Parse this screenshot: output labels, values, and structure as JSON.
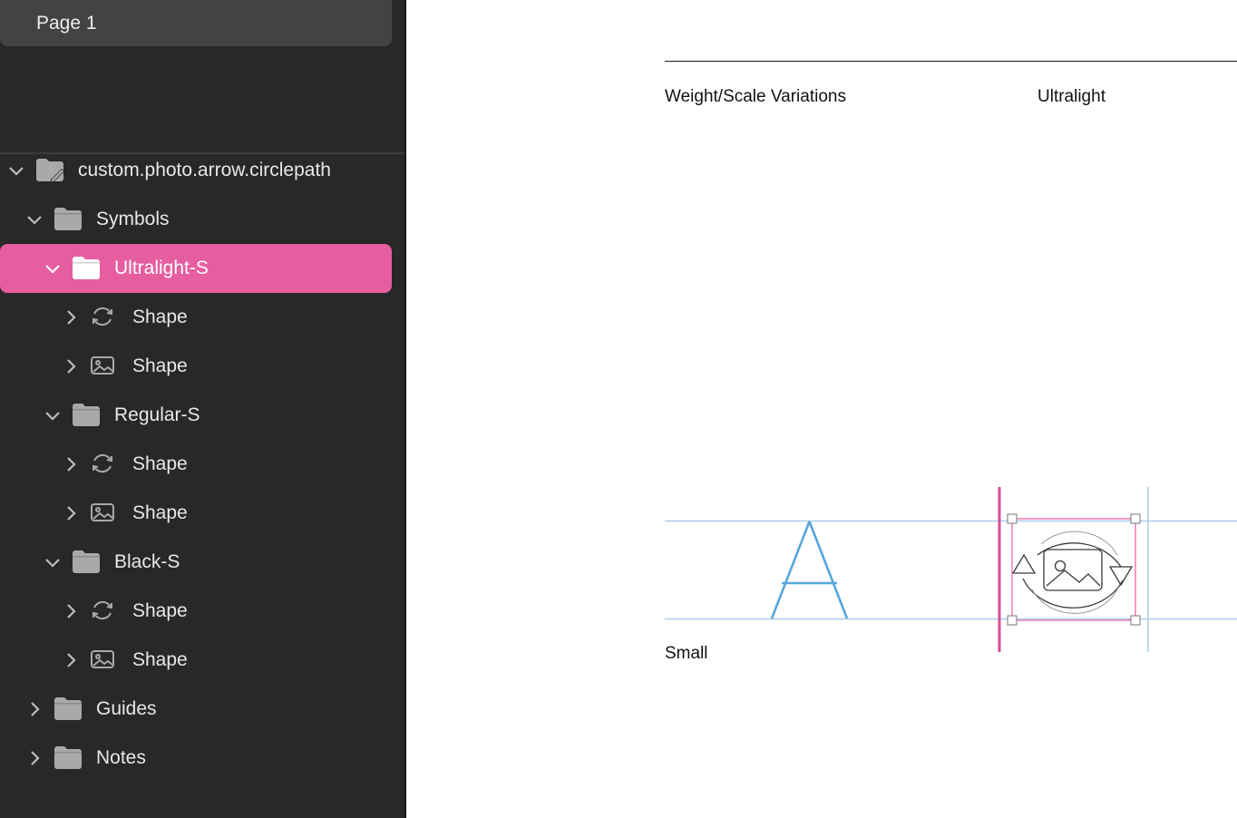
{
  "pages": {
    "current": "Page 1"
  },
  "layers": [
    {
      "label": "custom.photo.arrow.circlepath",
      "icon": "document-folder-icon",
      "expanded": true,
      "type": "folder"
    },
    {
      "label": "Symbols",
      "icon": "folder-icon",
      "expanded": true,
      "type": "folder"
    },
    {
      "label": "Ultralight-S",
      "icon": "folder-icon",
      "expanded": true,
      "type": "folder",
      "selected": true
    },
    {
      "label": "Shape",
      "icon": "circle-arrows-icon",
      "expanded": false,
      "type": "shape"
    },
    {
      "label": "Shape",
      "icon": "photo-icon",
      "expanded": false,
      "type": "shape"
    },
    {
      "label": "Regular-S",
      "icon": "folder-icon",
      "expanded": true,
      "type": "folder"
    },
    {
      "label": "Shape",
      "icon": "circle-arrows-icon",
      "expanded": false,
      "type": "shape"
    },
    {
      "label": "Shape",
      "icon": "photo-icon",
      "expanded": false,
      "type": "shape"
    },
    {
      "label": "Black-S",
      "icon": "folder-icon",
      "expanded": true,
      "type": "folder"
    },
    {
      "label": "Shape",
      "icon": "circle-arrows-icon",
      "expanded": false,
      "type": "shape"
    },
    {
      "label": "Shape",
      "icon": "photo-icon",
      "expanded": false,
      "type": "shape"
    },
    {
      "label": "Guides",
      "icon": "folder-icon",
      "expanded": false,
      "type": "folder"
    },
    {
      "label": "Notes",
      "icon": "folder-icon",
      "expanded": false,
      "type": "folder"
    }
  ],
  "canvas": {
    "header_left": "Weight/Scale Variations",
    "header_right": "Ultralight",
    "row_label": "Small",
    "reference_glyph": "A"
  },
  "colors": {
    "sidebar_bg": "#282828",
    "selection": "#e65da0",
    "guide_blue": "#a9cdea",
    "glyph_blue": "#56a6da",
    "margin_pink": "#d94d9a"
  }
}
